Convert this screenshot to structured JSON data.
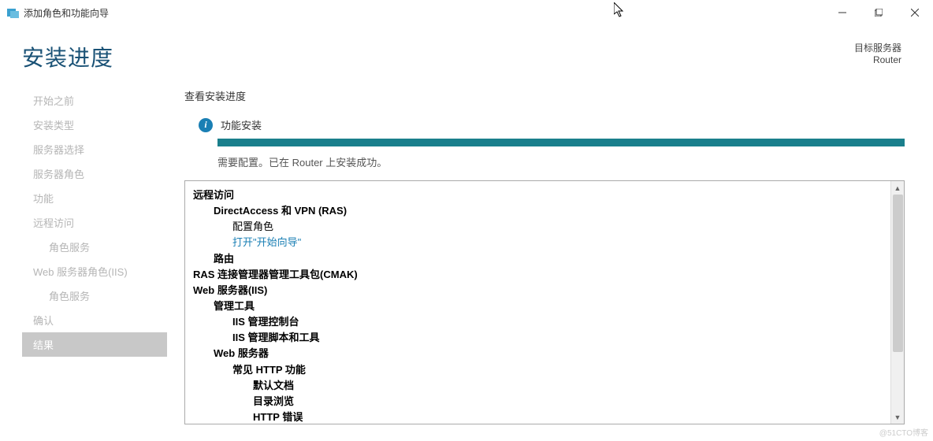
{
  "window": {
    "title": "添加角色和功能向导"
  },
  "header": {
    "page_title": "安装进度",
    "target_label": "目标服务器",
    "target_name": "Router"
  },
  "sidebar": {
    "items": [
      {
        "label": "开始之前",
        "active": false,
        "sub": false
      },
      {
        "label": "安装类型",
        "active": false,
        "sub": false
      },
      {
        "label": "服务器选择",
        "active": false,
        "sub": false
      },
      {
        "label": "服务器角色",
        "active": false,
        "sub": false
      },
      {
        "label": "功能",
        "active": false,
        "sub": false
      },
      {
        "label": "远程访问",
        "active": false,
        "sub": false
      },
      {
        "label": "角色服务",
        "active": false,
        "sub": true
      },
      {
        "label": "Web 服务器角色(IIS)",
        "active": false,
        "sub": false
      },
      {
        "label": "角色服务",
        "active": false,
        "sub": true
      },
      {
        "label": "确认",
        "active": false,
        "sub": false
      },
      {
        "label": "结果",
        "active": true,
        "sub": false
      }
    ]
  },
  "main": {
    "view_label": "查看安装进度",
    "status_title": "功能安装",
    "status_message": "需要配置。已在 Router 上安装成功。",
    "tree": [
      {
        "text": "远程访问",
        "level": 0,
        "bold": true
      },
      {
        "text": "DirectAccess 和 VPN (RAS)",
        "level": 1,
        "bold": true
      },
      {
        "text": "配置角色",
        "level": 2,
        "bold": false
      },
      {
        "text": "打开\"开始向导\"",
        "level": 2,
        "bold": false,
        "link": true
      },
      {
        "text": "路由",
        "level": 1,
        "bold": true
      },
      {
        "text": "RAS 连接管理器管理工具包(CMAK)",
        "level": 0,
        "bold": true
      },
      {
        "text": "Web 服务器(IIS)",
        "level": 0,
        "bold": true
      },
      {
        "text": "管理工具",
        "level": 1,
        "bold": true
      },
      {
        "text": "IIS 管理控制台",
        "level": 2,
        "bold": true
      },
      {
        "text": "IIS 管理脚本和工具",
        "level": 2,
        "bold": true
      },
      {
        "text": "Web 服务器",
        "level": 1,
        "bold": true
      },
      {
        "text": "常见 HTTP 功能",
        "level": 2,
        "bold": true
      },
      {
        "text": "默认文档",
        "level": 3,
        "bold": true
      },
      {
        "text": "目录浏览",
        "level": 3,
        "bold": true
      },
      {
        "text": "HTTP 错误",
        "level": 3,
        "bold": true
      }
    ]
  },
  "watermark": "@51CTO博客"
}
